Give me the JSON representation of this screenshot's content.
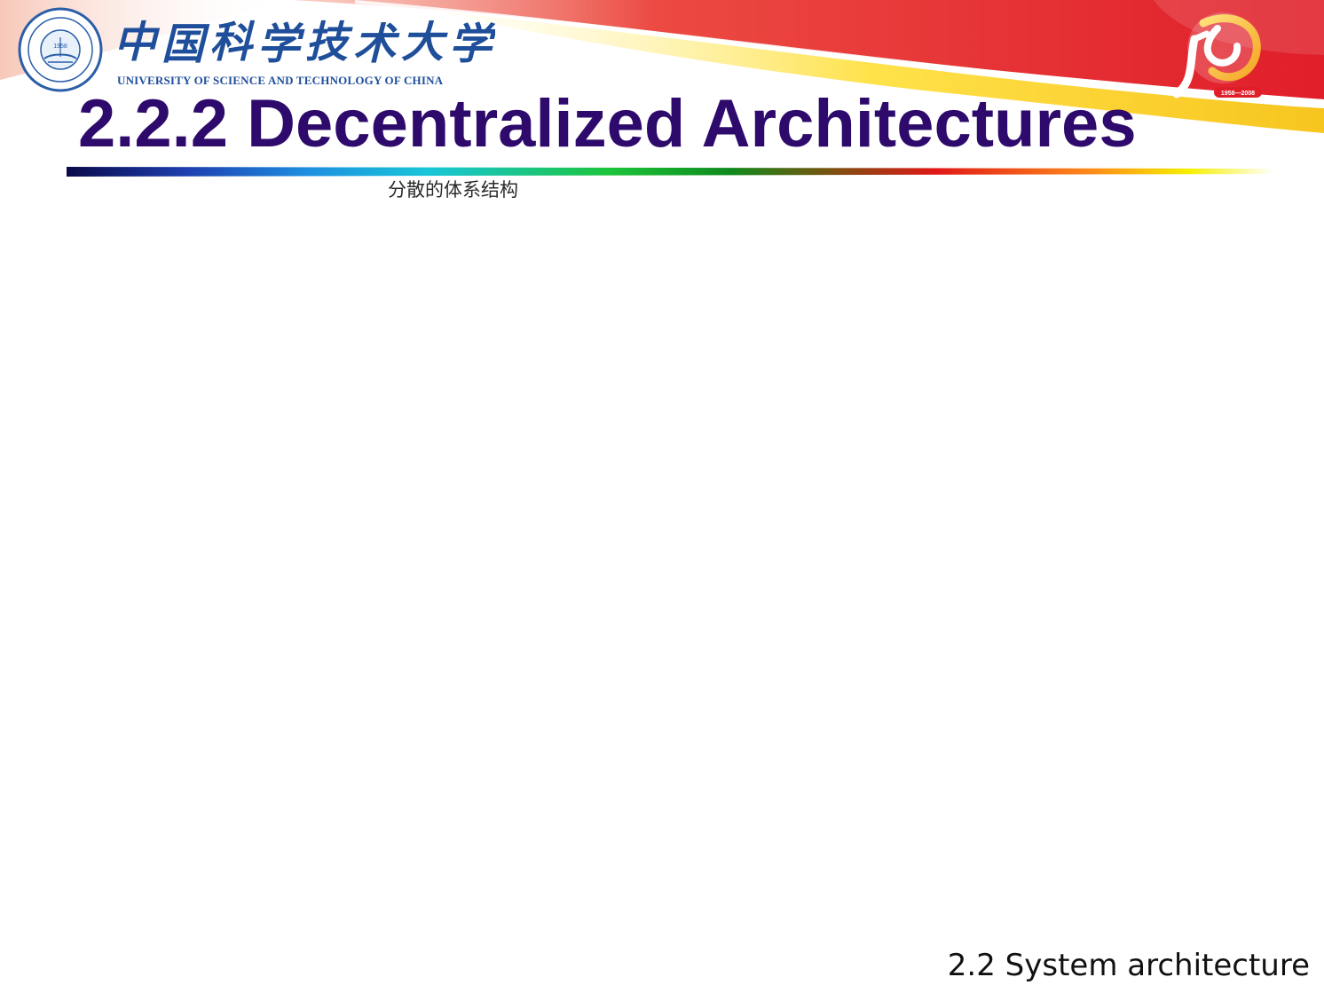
{
  "header": {
    "school_name_cn": "中国科学技术大学",
    "school_name_en": "UNIVERSITY OF SCIENCE AND TECHNOLOGY OF CHINA",
    "seal_year": "1958",
    "anniversary_years": "1958—2008",
    "icons": {
      "seal": "university-seal-icon",
      "anniversary": "anniversary-50-logo-icon"
    }
  },
  "slide": {
    "title": "2.2.2 Decentralized Architectures",
    "subtitle": "分散的体系结构"
  },
  "footer": {
    "section_label": "2.2 System architecture"
  },
  "colors": {
    "title": "#2d0a6b",
    "banner_red": "#e42530",
    "school_blue": "#1f4f9a",
    "underline_gradient": [
      "#0a0a4a",
      "#1e6fe0",
      "#19c6d8",
      "#1cc43a",
      "#0f8a1c",
      "#8a6a10",
      "#e01818",
      "#ff8c1a",
      "#f5f000",
      "#ffffff"
    ]
  }
}
